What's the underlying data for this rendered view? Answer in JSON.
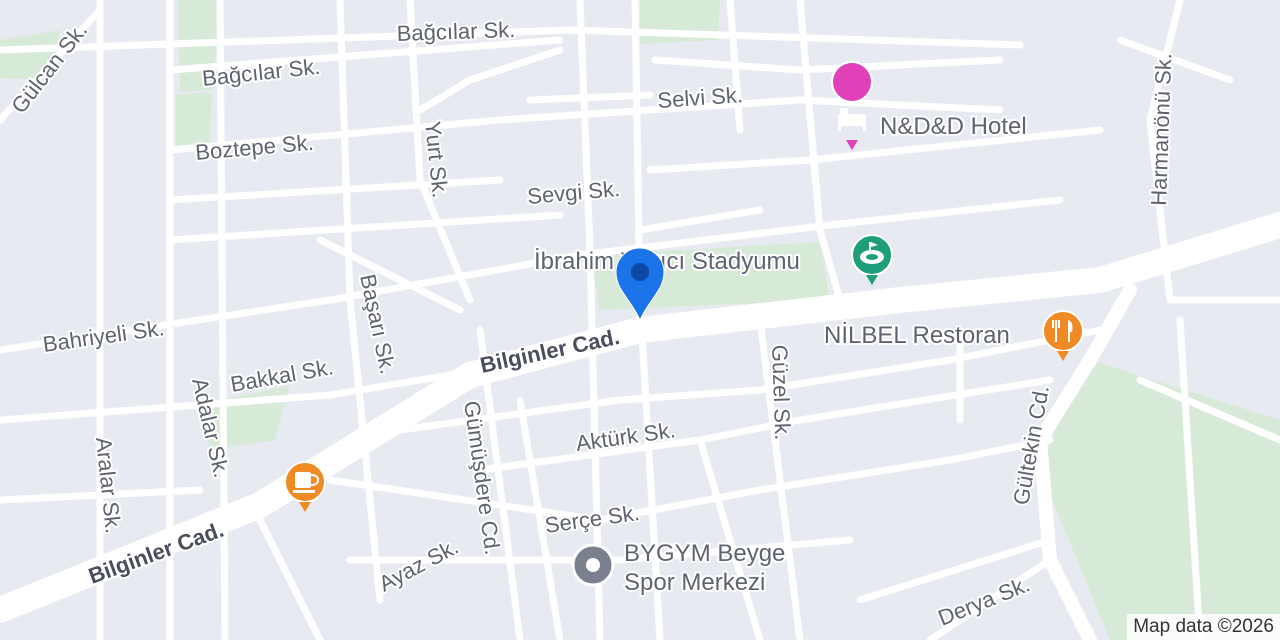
{
  "map": {
    "colors": {
      "background": "#e8eaf2",
      "road": "#ffffff",
      "park": "#d7ead8",
      "poi_pink": "#e040b8",
      "poi_green": "#1e9e7a",
      "poi_orange": "#f08a24",
      "poi_gray": "#7b808e",
      "marker_blue": "#1a73e8"
    },
    "streets": {
      "gulcan": "Gülcan Sk.",
      "bagcilar_top": "Bağcılar Sk.",
      "bagcilar_left": "Bağcılar Sk.",
      "boztepe": "Boztepe Sk.",
      "yurt": "Yurt Sk.",
      "selvi": "Selvi Sk.",
      "sevgi": "Sevgi Sk.",
      "harmanonu": "Harmanönü Sk.",
      "bahriyeli": "Bahriyeli Sk.",
      "basari": "Başarı Sk.",
      "bilginler_center": "Bilginler Cad.",
      "bilginler_left": "Bilginler Cad.",
      "bakkal": "Bakkal Sk.",
      "adalar": "Adalar Sk.",
      "aralar": "Aralar Sk.",
      "gumusdere": "Gümüşdere Cd.",
      "akturk": "Aktürk Sk.",
      "guzel": "Güzel Sk.",
      "gultekin": "Gültekin Cd.",
      "serce": "Serçe Sk.",
      "ayaz": "Ayaz Sk.",
      "derya": "Derya Sk."
    },
    "pois": {
      "hotel": {
        "name": "N&D&D Hotel",
        "icon": "bed-icon"
      },
      "stadium": {
        "name": "İbrahim Yazıcı Stadyumu",
        "icon": "stadium-icon"
      },
      "restaurant": {
        "name": "NİLBEL Restoran",
        "icon": "fork-knife-icon"
      },
      "cafe": {
        "icon": "coffee-cup-icon"
      },
      "gym": {
        "name_line1": "BYGYM Beyge",
        "name_line2": "Spor Merkezi",
        "icon": "place-dot-icon"
      }
    },
    "marker": {
      "icon": "location-pin-icon"
    },
    "attribution": "Map data ©2026"
  }
}
